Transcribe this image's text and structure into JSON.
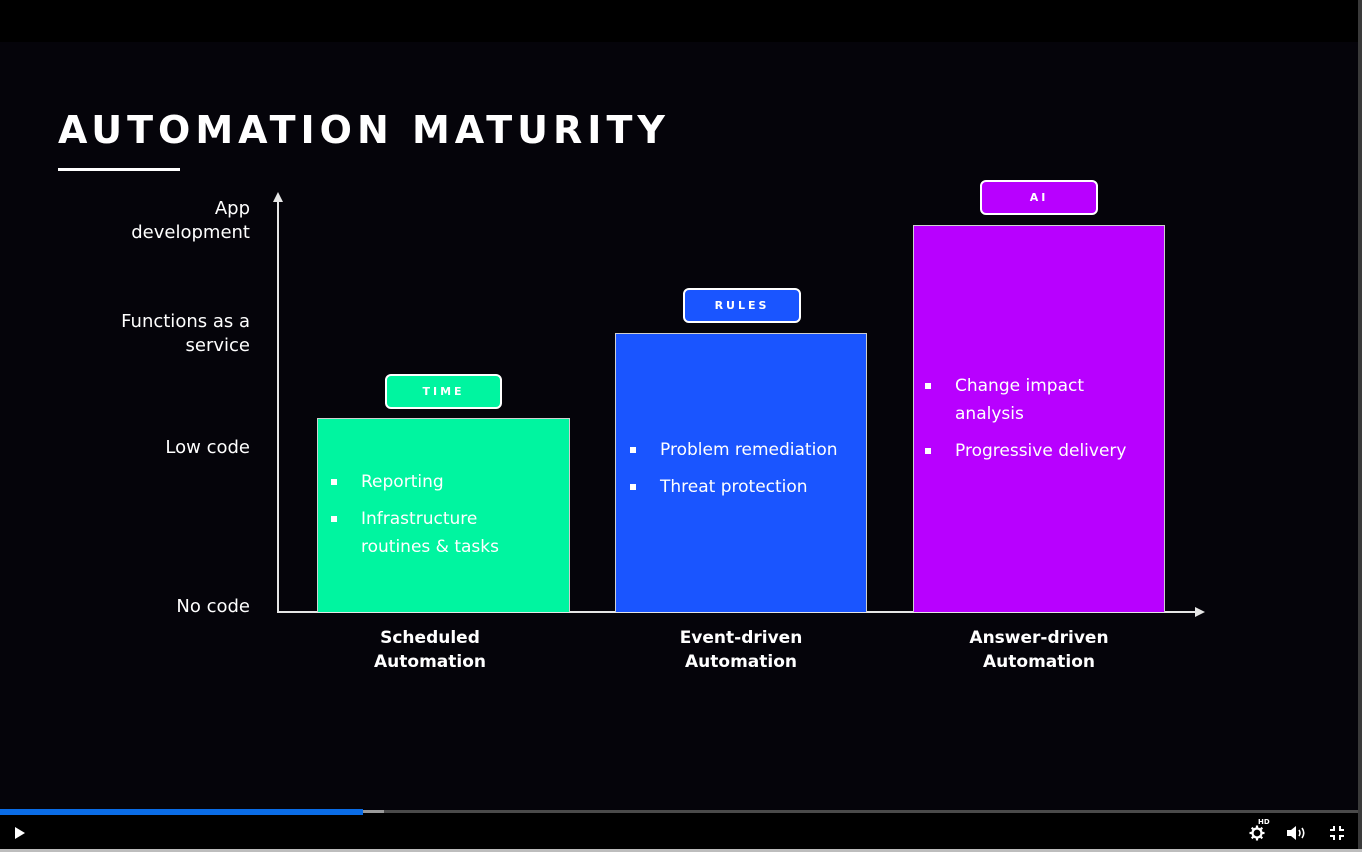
{
  "slide": {
    "title": "AUTOMATION MATURITY",
    "y_axis_labels": [
      {
        "line1": "App",
        "line2": "development"
      },
      {
        "line1": "Functions as a",
        "line2": "service"
      },
      {
        "line1": "Low code",
        "line2": ""
      },
      {
        "line1": "No code",
        "line2": ""
      }
    ],
    "columns": [
      {
        "tag": "TIME",
        "color": "#00f5a0",
        "level": "Low code",
        "items": [
          "Reporting",
          "Infrastructure routines & tasks"
        ],
        "label_line1": "Scheduled",
        "label_line2": "Automation"
      },
      {
        "tag": "RULES",
        "color": "#1a55ff",
        "level": "Functions as a service",
        "items": [
          "Problem remediation",
          "Threat protection"
        ],
        "label_line1": "Event-driven",
        "label_line2": "Automation"
      },
      {
        "tag": "AI",
        "color": "#b800ff",
        "level": "App development",
        "items": [
          "Change impact analysis",
          "Progressive delivery"
        ],
        "label_line1": "Answer-driven",
        "label_line2": "Automation"
      }
    ]
  },
  "player": {
    "progress_percent": 26.7,
    "buffered_percent": 28.3,
    "play_icon": "play-icon",
    "settings_icon": "gear-icon",
    "hd_badge": "HD",
    "volume_icon": "volume-icon",
    "fullscreen_exit_icon": "exit-fullscreen-icon",
    "accent": "#0a6ce6"
  }
}
